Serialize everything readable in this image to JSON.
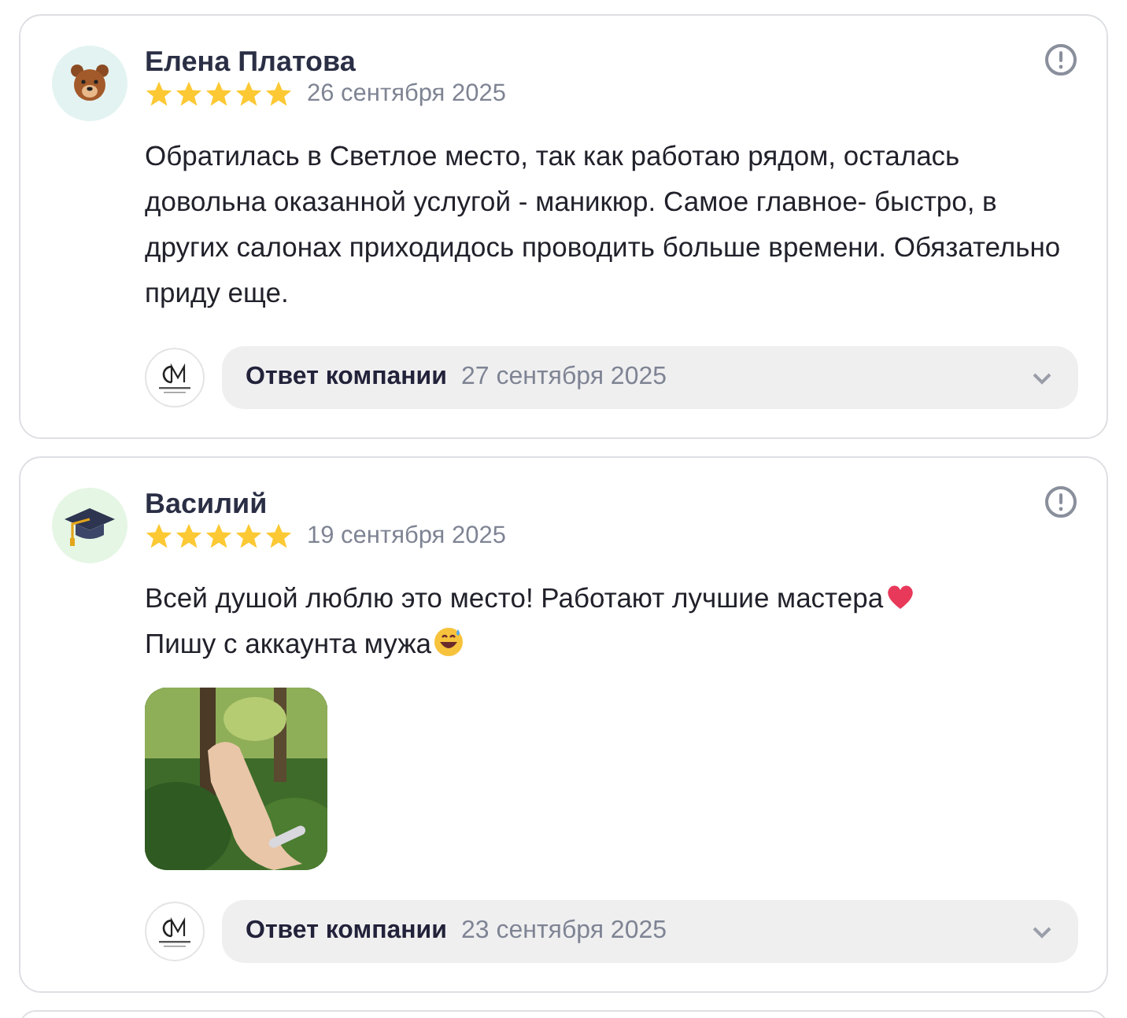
{
  "reviews": [
    {
      "author": "Елена Платова",
      "avatar": {
        "kind": "bear"
      },
      "stars": 5,
      "date": "26 сентября 2025",
      "text": [
        {
          "t": "Обратилась в Светлое место, так как работаю рядом, осталась довольна оказанной услугой - маникюр. Самое главное- быстро, в других салонах приходидось проводить больше времени. Обязательно приду еще."
        }
      ],
      "reply": {
        "label": "Ответ компании",
        "date": "27 сентября 2025",
        "expanded": false
      }
    },
    {
      "author": "Василий",
      "avatar": {
        "kind": "cap"
      },
      "stars": 5,
      "date": "19 сентября 2025",
      "text": [
        {
          "t": "Всей душой люблю это место! Работают лучшие мастера",
          "emoji": {
            "kind": "heart"
          }
        },
        {
          "t": "Пишу с аккаунта мужа",
          "emoji": {
            "kind": "smile"
          }
        }
      ],
      "photos": [
        {
          "kind": "picture"
        }
      ],
      "reply": {
        "label": "Ответ компании",
        "date": "23 сентября 2025",
        "expanded": false
      }
    }
  ]
}
